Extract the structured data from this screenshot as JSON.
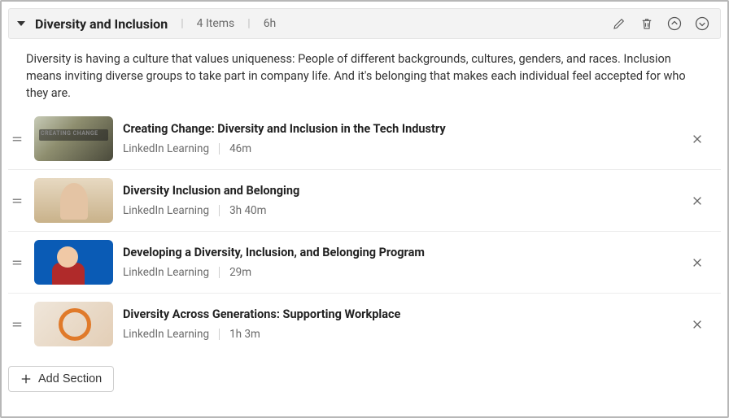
{
  "section": {
    "title": "Diversity and Inclusion",
    "item_count_label": "4 Items",
    "duration_label": "6h",
    "description": "Diversity is having a culture that values uniqueness: People of different backgrounds, cultures, genders, and races. Inclusion means inviting diverse groups to take part in company life. And it's belonging that makes each individual feel accepted for who they are."
  },
  "thumb_overlays": {
    "creating_change": "CREATING CHANGE"
  },
  "items": [
    {
      "title": "Creating Change: Diversity and Inclusion in the Tech Industry",
      "source": "LinkedIn Learning",
      "duration": "46m"
    },
    {
      "title": "Diversity Inclusion and Belonging",
      "source": "LinkedIn Learning",
      "duration": "3h 40m"
    },
    {
      "title": "Developing a Diversity, Inclusion, and Belonging Program",
      "source": "LinkedIn Learning",
      "duration": "29m"
    },
    {
      "title": "Diversity Across Generations: Supporting Workplace",
      "source": "LinkedIn Learning",
      "duration": "1h 3m"
    }
  ],
  "buttons": {
    "add_section": "Add Section"
  }
}
